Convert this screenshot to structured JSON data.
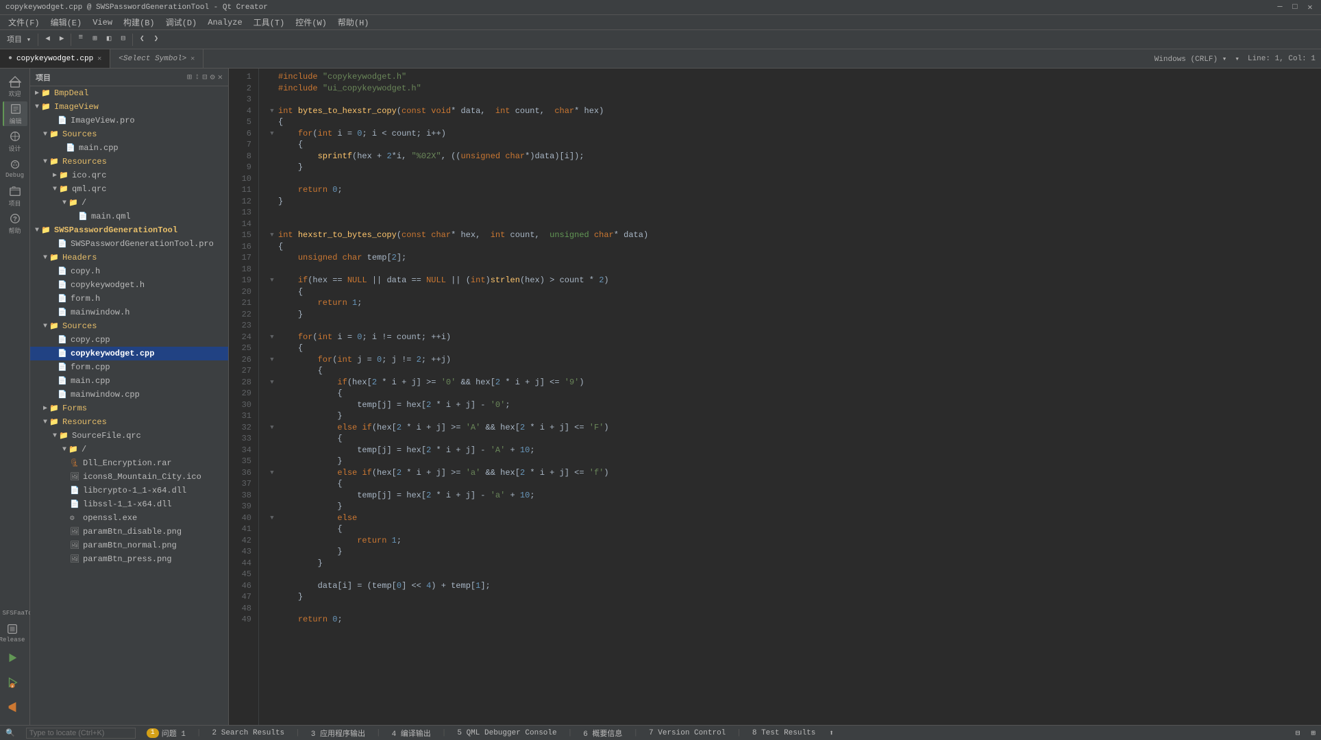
{
  "titleBar": {
    "text": "copykeywodget.cpp @ SWSPasswordGenerationTool - Qt Creator",
    "minimize": "─",
    "restore": "□",
    "close": "✕"
  },
  "menuBar": {
    "items": [
      "文件(F)",
      "编辑(E)",
      "View",
      "构建(B)",
      "调试(D)",
      "Analyze",
      "工具(T)",
      "控件(W)",
      "帮助(H)"
    ]
  },
  "tabs": {
    "active": "copykeywodget.cpp",
    "items": [
      {
        "label": "copykeywodget.cpp",
        "closable": true
      },
      {
        "label": "<Select Symbol>",
        "closable": false
      }
    ],
    "rightInfo": "Windows (CRLF)",
    "lineCol": "Line: 1, Col: 1"
  },
  "fileTree": {
    "panelTitle": "项目",
    "items": [
      {
        "level": 0,
        "type": "folder",
        "label": "BmpDeal",
        "expanded": false,
        "arrow": "▶"
      },
      {
        "level": 0,
        "type": "folder",
        "label": "ImageView",
        "expanded": true,
        "arrow": "▼"
      },
      {
        "level": 1,
        "type": "pro",
        "label": "ImageView.pro"
      },
      {
        "level": 1,
        "type": "folder",
        "label": "Sources",
        "expanded": true,
        "arrow": "▼"
      },
      {
        "level": 2,
        "type": "cpp",
        "label": "main.cpp"
      },
      {
        "level": 1,
        "type": "folder",
        "label": "Resources",
        "expanded": true,
        "arrow": "▼"
      },
      {
        "level": 2,
        "type": "folder",
        "label": "ico.qrc",
        "expanded": false,
        "arrow": "▶"
      },
      {
        "level": 2,
        "type": "folder",
        "label": "qml.qrc",
        "expanded": true,
        "arrow": "▼"
      },
      {
        "level": 3,
        "type": "folder",
        "label": "/",
        "expanded": true,
        "arrow": "▼"
      },
      {
        "level": 4,
        "type": "qml",
        "label": "main.qml"
      },
      {
        "level": 0,
        "type": "folder",
        "label": "SWSPasswordGenerationTool",
        "expanded": true,
        "arrow": "▼",
        "bold": true
      },
      {
        "level": 1,
        "type": "pro",
        "label": "SWSPasswordGenerationTool.pro"
      },
      {
        "level": 1,
        "type": "folder",
        "label": "Headers",
        "expanded": true,
        "arrow": "▼"
      },
      {
        "level": 2,
        "type": "h",
        "label": "copy.h"
      },
      {
        "level": 2,
        "type": "h",
        "label": "copykeywodget.h"
      },
      {
        "level": 2,
        "type": "h",
        "label": "form.h"
      },
      {
        "level": 2,
        "type": "h",
        "label": "mainwindow.h"
      },
      {
        "level": 1,
        "type": "folder",
        "label": "Sources",
        "expanded": true,
        "arrow": "▼"
      },
      {
        "level": 2,
        "type": "cpp",
        "label": "copy.cpp"
      },
      {
        "level": 2,
        "type": "cpp",
        "label": "copykeywodget.cpp",
        "active": true
      },
      {
        "level": 2,
        "type": "cpp",
        "label": "form.cpp"
      },
      {
        "level": 2,
        "type": "cpp",
        "label": "main.cpp"
      },
      {
        "level": 2,
        "type": "cpp",
        "label": "mainwindow.cpp"
      },
      {
        "level": 1,
        "type": "folder",
        "label": "Forms",
        "expanded": false,
        "arrow": "▶"
      },
      {
        "level": 1,
        "type": "folder",
        "label": "Resources",
        "expanded": true,
        "arrow": "▼"
      },
      {
        "level": 2,
        "type": "qrc",
        "label": "SourceFile.qrc",
        "expanded": true,
        "arrow": "▼"
      },
      {
        "level": 3,
        "type": "folder",
        "label": "/",
        "expanded": true,
        "arrow": "▼"
      },
      {
        "level": 4,
        "type": "rar",
        "label": "Dll_Encryption.rar"
      },
      {
        "level": 4,
        "type": "img",
        "label": "icons8_Mountain_City.ico"
      },
      {
        "level": 4,
        "type": "dll",
        "label": "libcrypto-1_1-x64.dll"
      },
      {
        "level": 4,
        "type": "dll",
        "label": "libssl-1_1-x64.dll"
      },
      {
        "level": 4,
        "type": "exe",
        "label": "openssl.exe"
      },
      {
        "level": 4,
        "type": "png",
        "label": "paramBtn_disable.png"
      },
      {
        "level": 4,
        "type": "png",
        "label": "paramBtn_normal.png"
      },
      {
        "level": 4,
        "type": "png",
        "label": "paramBtn_press.png"
      }
    ]
  },
  "sidebarIcons": [
    {
      "icon": "≡",
      "label": "欢迎"
    },
    {
      "icon": "✎",
      "label": "编辑",
      "active": true
    },
    {
      "icon": "⚙",
      "label": "设计"
    },
    {
      "icon": "🐛",
      "label": "Debug"
    },
    {
      "icon": "⚡",
      "label": "项目"
    },
    {
      "icon": "?",
      "label": "帮助"
    }
  ],
  "sidebarBottom": [
    {
      "icon": "↗",
      "label": "Release"
    },
    {
      "icon": "▶",
      "label": ""
    },
    {
      "icon": "⊙",
      "label": ""
    },
    {
      "icon": "⚡",
      "label": ""
    }
  ],
  "code": {
    "filename": "copykeywodget.cpp",
    "lines": [
      {
        "n": 1,
        "fold": false,
        "content": "<span class='kw'>#include</span> <span class='str'>\"copykeywodget.h\"</span>"
      },
      {
        "n": 2,
        "fold": false,
        "content": "<span class='kw'>#include</span> <span class='str'>\"ui_copykeywodget.h\"</span>"
      },
      {
        "n": 3,
        "fold": false,
        "content": ""
      },
      {
        "n": 4,
        "fold": true,
        "content": "<span class='kw'>int</span> <span class='fn'>bytes_to_hexstr_copy</span><span class='op'>(</span><span class='kw'>const</span> <span class='kw'>void</span><span class='op'>*</span> data,  <span class='kw'>int</span> count,  <span class='kw'>char</span><span class='op'>*</span> hex<span class='op'>)</span>"
      },
      {
        "n": 5,
        "fold": false,
        "content": "<span class='op'>{</span>"
      },
      {
        "n": 6,
        "fold": true,
        "content": "    <span class='kw'>for</span><span class='op'>(</span><span class='kw'>int</span> i <span class='op'>=</span> <span class='num'>0</span><span class='op'>;</span> i <span class='op'>&lt;</span> count<span class='op'>;</span> i<span class='op'>++)</span>"
      },
      {
        "n": 7,
        "fold": false,
        "content": "    <span class='op'>{</span>"
      },
      {
        "n": 8,
        "fold": false,
        "content": "        <span class='fn'>sprintf</span><span class='op'>(</span>hex <span class='op'>+</span> <span class='num'>2</span><span class='op'>*</span>i<span class='op'>,</span> <span class='str'>\"%02X\"</span><span class='op'>,</span> <span class='op'>((</span><span class='kw'>unsigned</span> <span class='kw'>char</span><span class='op'>*)</span>data<span class='op'>)[</span>i<span class='op'>]);</span>"
      },
      {
        "n": 9,
        "fold": false,
        "content": "    <span class='op'>}</span>"
      },
      {
        "n": 10,
        "fold": false,
        "content": ""
      },
      {
        "n": 11,
        "fold": false,
        "content": "    <span class='kw'>return</span> <span class='num'>0</span><span class='op'>;</span>"
      },
      {
        "n": 12,
        "fold": false,
        "content": "<span class='op'>}</span>"
      },
      {
        "n": 13,
        "fold": false,
        "content": ""
      },
      {
        "n": 14,
        "fold": false,
        "content": ""
      },
      {
        "n": 15,
        "fold": true,
        "content": "<span class='kw'>int</span> <span class='fn'>hexstr_to_bytes_copy</span><span class='op'>(</span><span class='kw'>const</span> <span class='kw'>char</span><span class='op'>*</span> hex,  <span class='kw'>int</span> count,  <span class='kw2'>unsigned</span> <span class='kw'>char</span><span class='op'>*</span> data<span class='op'>)</span>"
      },
      {
        "n": 16,
        "fold": false,
        "content": "<span class='op'>{</span>"
      },
      {
        "n": 17,
        "fold": false,
        "content": "    <span class='kw'>unsigned</span> <span class='kw'>char</span> temp<span class='op'>[</span><span class='num'>2</span><span class='op'>];</span>"
      },
      {
        "n": 18,
        "fold": false,
        "content": ""
      },
      {
        "n": 19,
        "fold": true,
        "content": "    <span class='kw'>if</span><span class='op'>(</span>hex <span class='op'>==</span> <span class='kw'>NULL</span> <span class='op'>||</span> data <span class='op'>==</span> <span class='kw'>NULL</span> <span class='op'>||</span> <span class='op'>(</span><span class='kw'>int</span><span class='op'>)</span><span class='fn'>strlen</span><span class='op'>(</span>hex<span class='op'>)</span> <span class='op'>&gt;</span> count <span class='op'>*</span> <span class='num'>2</span><span class='op'>)</span>"
      },
      {
        "n": 20,
        "fold": false,
        "content": "    <span class='op'>{</span>"
      },
      {
        "n": 21,
        "fold": false,
        "content": "        <span class='kw'>return</span> <span class='num'>1</span><span class='op'>;</span>"
      },
      {
        "n": 22,
        "fold": false,
        "content": "    <span class='op'>}</span>"
      },
      {
        "n": 23,
        "fold": false,
        "content": ""
      },
      {
        "n": 24,
        "fold": true,
        "content": "    <span class='kw'>for</span><span class='op'>(</span><span class='kw'>int</span> i <span class='op'>=</span> <span class='num'>0</span><span class='op'>;</span> i <span class='op'>!=</span> count<span class='op'>;</span> <span class='op'>++</span>i<span class='op'>)</span>"
      },
      {
        "n": 25,
        "fold": false,
        "content": "    <span class='op'>{</span>"
      },
      {
        "n": 26,
        "fold": true,
        "content": "        <span class='kw'>for</span><span class='op'>(</span><span class='kw'>int</span> j <span class='op'>=</span> <span class='num'>0</span><span class='op'>;</span> j <span class='op'>!=</span> <span class='num'>2</span><span class='op'>;</span> <span class='op'>++</span>j<span class='op'>)</span>"
      },
      {
        "n": 27,
        "fold": false,
        "content": "        <span class='op'>{</span>"
      },
      {
        "n": 28,
        "fold": true,
        "content": "            <span class='kw'>if</span><span class='op'>(</span>hex<span class='op'>[</span><span class='num'>2</span> <span class='op'>*</span> i <span class='op'>+</span> j<span class='op'>]</span> <span class='op'>&gt;=</span> <span class='ch'>'0'</span> <span class='op'>&amp;&amp;</span> hex<span class='op'>[</span><span class='num'>2</span> <span class='op'>*</span> i <span class='op'>+</span> j<span class='op'>]</span> <span class='op'>&lt;=</span> <span class='ch'>'9'</span><span class='op'>)</span>"
      },
      {
        "n": 29,
        "fold": false,
        "content": "            <span class='op'>{</span>"
      },
      {
        "n": 30,
        "fold": false,
        "content": "                temp<span class='op'>[</span>j<span class='op'>]</span> <span class='op'>=</span> hex<span class='op'>[</span><span class='num'>2</span> <span class='op'>*</span> i <span class='op'>+</span> j<span class='op'>]</span> <span class='op'>-</span> <span class='ch'>'0'</span><span class='op'>;</span>"
      },
      {
        "n": 31,
        "fold": false,
        "content": "            <span class='op'>}</span>"
      },
      {
        "n": 32,
        "fold": true,
        "content": "            <span class='kw'>else</span> <span class='kw'>if</span><span class='op'>(</span>hex<span class='op'>[</span><span class='num'>2</span> <span class='op'>*</span> i <span class='op'>+</span> j<span class='op'>]</span> <span class='op'>&gt;=</span> <span class='ch'>'A'</span> <span class='op'>&amp;&amp;</span> hex<span class='op'>[</span><span class='num'>2</span> <span class='op'>*</span> i <span class='op'>+</span> j<span class='op'>]</span> <span class='op'>&lt;=</span> <span class='ch'>'F'</span><span class='op'>)</span>"
      },
      {
        "n": 33,
        "fold": false,
        "content": "            <span class='op'>{</span>"
      },
      {
        "n": 34,
        "fold": false,
        "content": "                temp<span class='op'>[</span>j<span class='op'>]</span> <span class='op'>=</span> hex<span class='op'>[</span><span class='num'>2</span> <span class='op'>*</span> i <span class='op'>+</span> j<span class='op'>]</span> <span class='op'>-</span> <span class='ch'>'A'</span> <span class='op'>+</span> <span class='num'>10</span><span class='op'>;</span>"
      },
      {
        "n": 35,
        "fold": false,
        "content": "            <span class='op'>}</span>"
      },
      {
        "n": 36,
        "fold": true,
        "content": "            <span class='kw'>else</span> <span class='kw'>if</span><span class='op'>(</span>hex<span class='op'>[</span><span class='num'>2</span> <span class='op'>*</span> i <span class='op'>+</span> j<span class='op'>]</span> <span class='op'>&gt;=</span> <span class='ch'>'a'</span> <span class='op'>&amp;&amp;</span> hex<span class='op'>[</span><span class='num'>2</span> <span class='op'>*</span> i <span class='op'>+</span> j<span class='op'>]</span> <span class='op'>&lt;=</span> <span class='ch'>'f'</span><span class='op'>)</span>"
      },
      {
        "n": 37,
        "fold": false,
        "content": "            <span class='op'>{</span>"
      },
      {
        "n": 38,
        "fold": false,
        "content": "                temp<span class='op'>[</span>j<span class='op'>]</span> <span class='op'>=</span> hex<span class='op'>[</span><span class='num'>2</span> <span class='op'>*</span> i <span class='op'>+</span> j<span class='op'>]</span> <span class='op'>-</span> <span class='ch'>'a'</span> <span class='op'>+</span> <span class='num'>10</span><span class='op'>;</span>"
      },
      {
        "n": 39,
        "fold": false,
        "content": "            <span class='op'>}</span>"
      },
      {
        "n": 40,
        "fold": true,
        "content": "            <span class='kw'>else</span>"
      },
      {
        "n": 41,
        "fold": false,
        "content": "            <span class='op'>{</span>"
      },
      {
        "n": 42,
        "fold": false,
        "content": "                <span class='kw'>return</span> <span class='num'>1</span><span class='op'>;</span>"
      },
      {
        "n": 43,
        "fold": false,
        "content": "            <span class='op'>}</span>"
      },
      {
        "n": 44,
        "fold": false,
        "content": "        <span class='op'>}</span>"
      },
      {
        "n": 45,
        "fold": false,
        "content": ""
      },
      {
        "n": 46,
        "fold": false,
        "content": "        data<span class='op'>[</span>i<span class='op'>]</span> <span class='op'>=</span> <span class='op'>(</span>temp<span class='op'>[</span><span class='num'>0</span><span class='op'>]</span> <span class='op'>&lt;&lt;</span> <span class='num'>4</span><span class='op'>)</span> <span class='op'>+</span> temp<span class='op'>[</span><span class='num'>1</span><span class='op'>];</span>"
      },
      {
        "n": 47,
        "fold": false,
        "content": "    <span class='op'>}</span>"
      },
      {
        "n": 48,
        "fold": false,
        "content": ""
      },
      {
        "n": 49,
        "fold": false,
        "content": "    <span class='kw'>return</span> <span class='num'>0</span><span class='op'>;</span>"
      }
    ]
  },
  "statusBar": {
    "items": [
      {
        "label": "1 问题 1"
      },
      {
        "label": "2 Search Results"
      },
      {
        "label": "3 应用程序输出"
      },
      {
        "label": "4 编译输出"
      },
      {
        "label": "5 QML Debugger Console"
      },
      {
        "label": "6 概要信息"
      },
      {
        "label": "7 Version Control"
      },
      {
        "label": "8 Test Results"
      }
    ],
    "searchPlaceholder": "Type to locate (Ctrl+K)"
  }
}
